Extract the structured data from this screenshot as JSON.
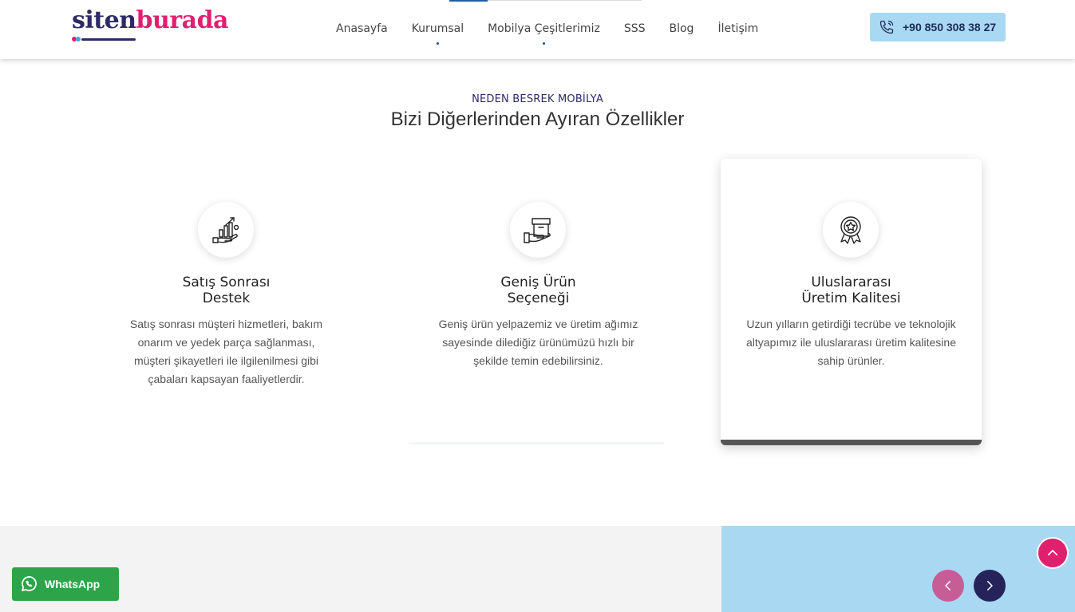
{
  "brand": {
    "part1": "siten",
    "part2": "burada"
  },
  "nav": {
    "items": [
      {
        "label": "Anasayfa",
        "dot": false
      },
      {
        "label": "Kurumsal",
        "dot": true
      },
      {
        "label": "Mobilya Çeşitlerimiz",
        "dot": true
      },
      {
        "label": "SSS",
        "dot": false
      },
      {
        "label": "Blog",
        "dot": false
      },
      {
        "label": "İletişim",
        "dot": false
      }
    ]
  },
  "phone": {
    "icon": "phone-icon",
    "label": "+90 850 308 38 27"
  },
  "section": {
    "eyebrow": "NEDEN BESREK MOBİLYA",
    "title": "Bizi Diğerlerinden Ayıran Özellikler"
  },
  "features": [
    {
      "icon": "growth-chart-hand-icon",
      "title": "Satış Sonrası\nDestek",
      "text": "Satış sonrası müşteri hizmetleri, bakım onarım ve yedek parça sağlanması, müşteri şikayetleri ile ilgilenilmesi gibi çabaları kapsayan faaliyetlerdir."
    },
    {
      "icon": "box-hand-icon",
      "title": "Geniş Ürün\nSeçeneği",
      "text": "Geniş ürün yelpazemiz ve üretim ağımız sayesinde dilediğiz ürünümüzü hızlı bir şekilde temin edebilirsiniz."
    },
    {
      "icon": "award-badge-icon",
      "title": "Uluslararası\nÜretim Kalitesi",
      "text": "Uzun yılların getirdiği tecrübe ve teknolojik altyapımız ile uluslararası üretim kalitesine sahip ürünler."
    }
  ],
  "whatsapp": {
    "icon": "whatsapp-icon",
    "label": "WhatsApp"
  },
  "colors": {
    "brand_navy": "#2d2a66",
    "brand_pink": "#e0206f",
    "light_blue": "#a9d8f2",
    "whatsapp_green": "#2ea44a",
    "arrow_prev": "#c65d97",
    "arrow_next": "#25235a"
  }
}
